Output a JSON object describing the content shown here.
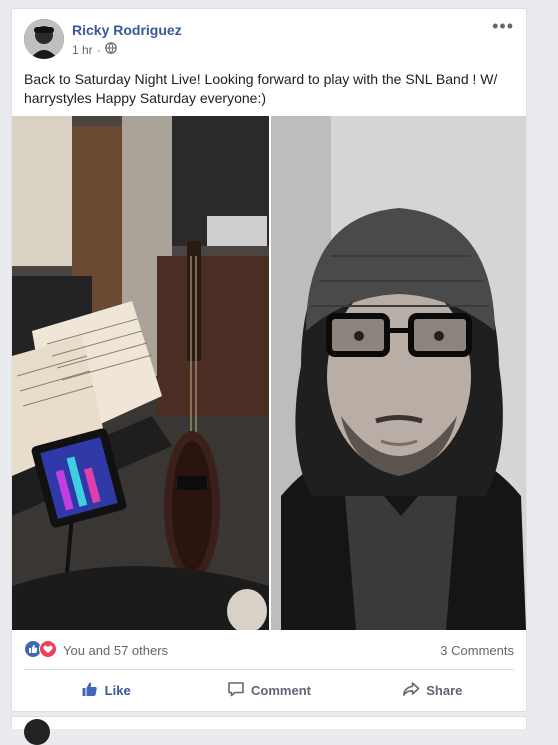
{
  "post": {
    "author": "Ricky Rodriguez",
    "timestamp": "1 hr",
    "privacy_icon": "globe-icon",
    "more_icon": "more-options-icon",
    "text": "Back to Saturday Night Live! Looking forward to play with the SNL Band ! W/ harrystyles Happy Saturday everyone:)"
  },
  "photos": [
    {
      "description_icon": "bass-guitar-on-stage-photo"
    },
    {
      "description_icon": "selfie-in-beanie-photo"
    }
  ],
  "reactions": {
    "icons": [
      "like-reaction-icon",
      "love-reaction-icon"
    ],
    "count_text": "You and 57 others",
    "comments_text": "3 Comments"
  },
  "actions": {
    "like": "Like",
    "comment": "Comment",
    "share": "Share"
  },
  "colors": {
    "link_blue": "#385898",
    "like_blue": "#4267b2",
    "love_red": "#f33e58",
    "background": "#e9ebee"
  }
}
